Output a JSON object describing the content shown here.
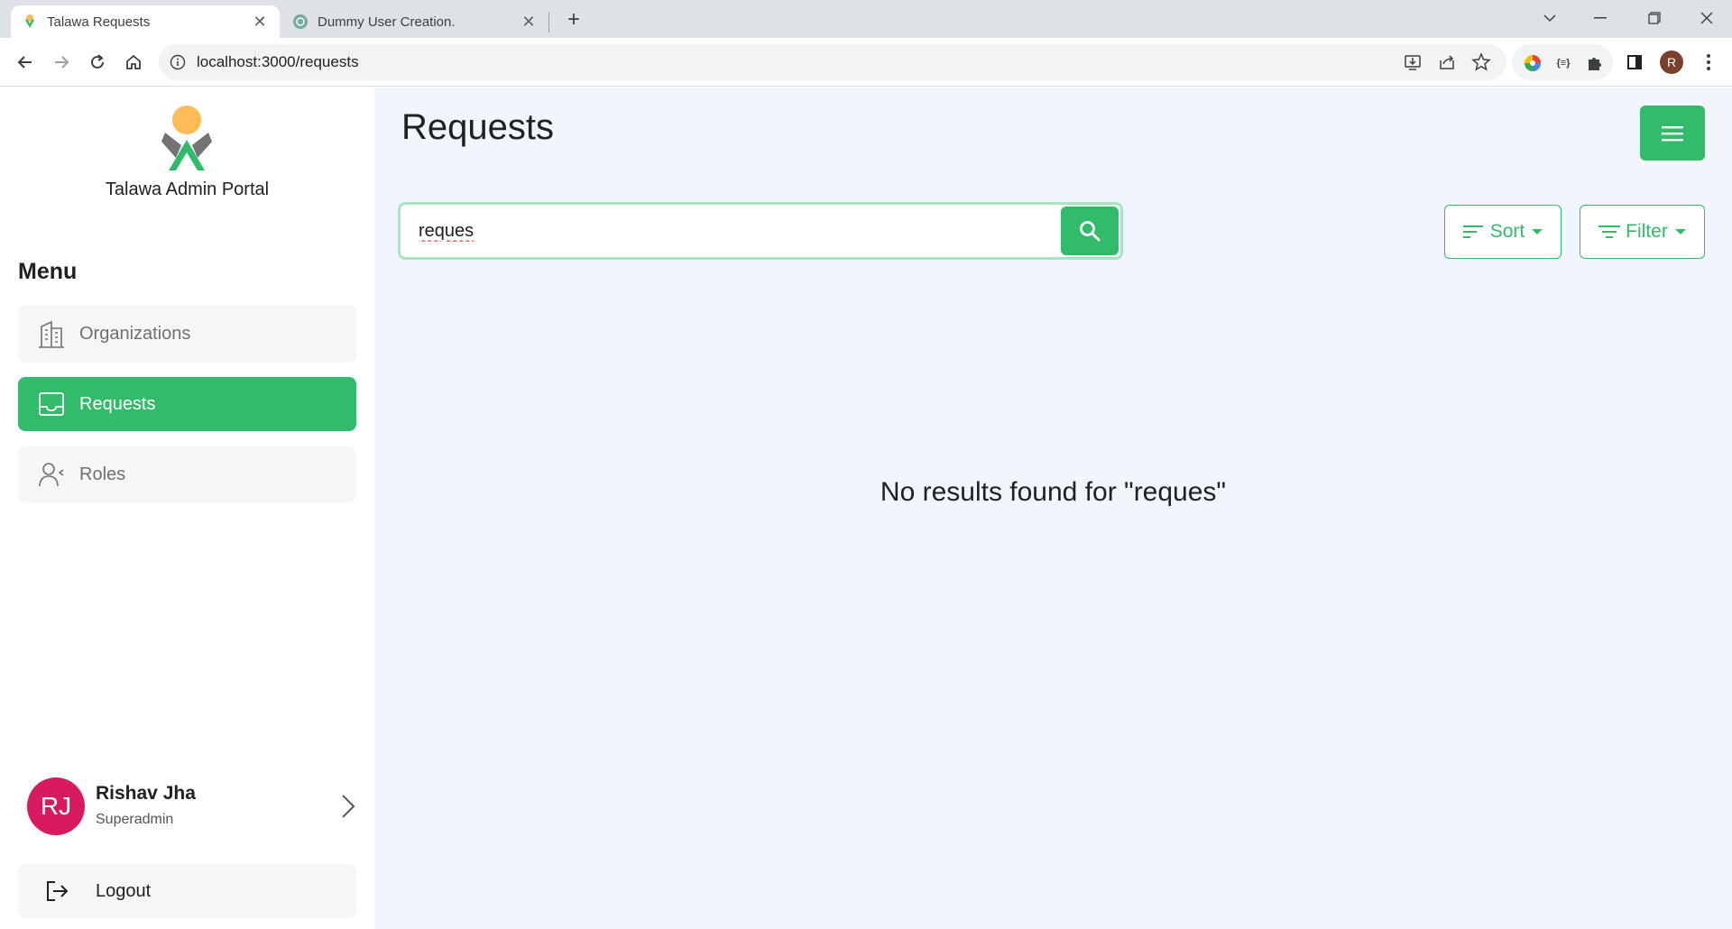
{
  "browser": {
    "tabs": [
      {
        "title": "Talawa Requests",
        "active": true
      },
      {
        "title": "Dummy User Creation.",
        "active": false
      }
    ],
    "url": "localhost:3000/requests",
    "profile_initial": "R"
  },
  "sidebar": {
    "portal_name": "Talawa Admin Portal",
    "menu_title": "Menu",
    "items": [
      {
        "label": "Organizations",
        "icon": "building-icon",
        "active": false
      },
      {
        "label": "Requests",
        "icon": "inbox-icon",
        "active": true
      },
      {
        "label": "Roles",
        "icon": "user-roles-icon",
        "active": false
      }
    ],
    "user": {
      "initials": "RJ",
      "name": "Rishav Jha",
      "role": "Superadmin"
    },
    "logout_label": "Logout"
  },
  "main": {
    "title": "Requests",
    "search": {
      "value": "reques",
      "placeholder": ""
    },
    "sort_label": "Sort",
    "filter_label": "Filter",
    "empty_message": "No results found for \"reques\""
  },
  "colors": {
    "accent": "#31bb6b",
    "avatar": "#d81b60",
    "main_bg": "#f1f6fd"
  }
}
